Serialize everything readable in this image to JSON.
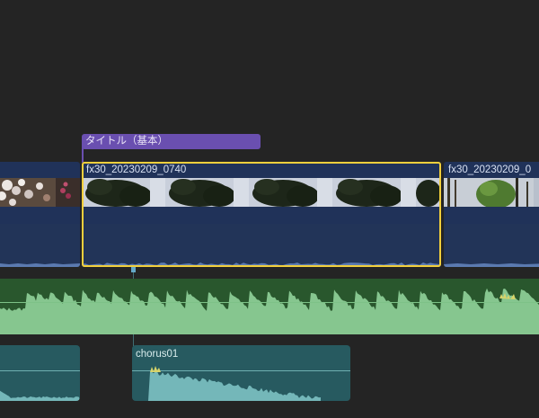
{
  "timeline": {
    "title_clip": {
      "label": "タイトル（基本）"
    },
    "video_clips": [
      {
        "name": "",
        "selected": false
      },
      {
        "name": "fx30_20230209_0740",
        "selected": true
      },
      {
        "name": "fx30_20230209_0"
      }
    ],
    "music_clip": {
      "name": ""
    },
    "sfx_clips": [
      {
        "name": ""
      },
      {
        "name": "chorus01"
      }
    ]
  },
  "colors": {
    "background": "#242424",
    "title_clip": "#6a4fb0",
    "video_clip": "#203259",
    "selection": "#f2cf3c",
    "music_track": "#29572d",
    "music_wave": "#86c68f",
    "sfx_clip": "#275a60",
    "sfx_wave": "#74b7b9",
    "peak_wave": "#d8d46a"
  },
  "icons": [
    "playhead-marker-icon"
  ]
}
